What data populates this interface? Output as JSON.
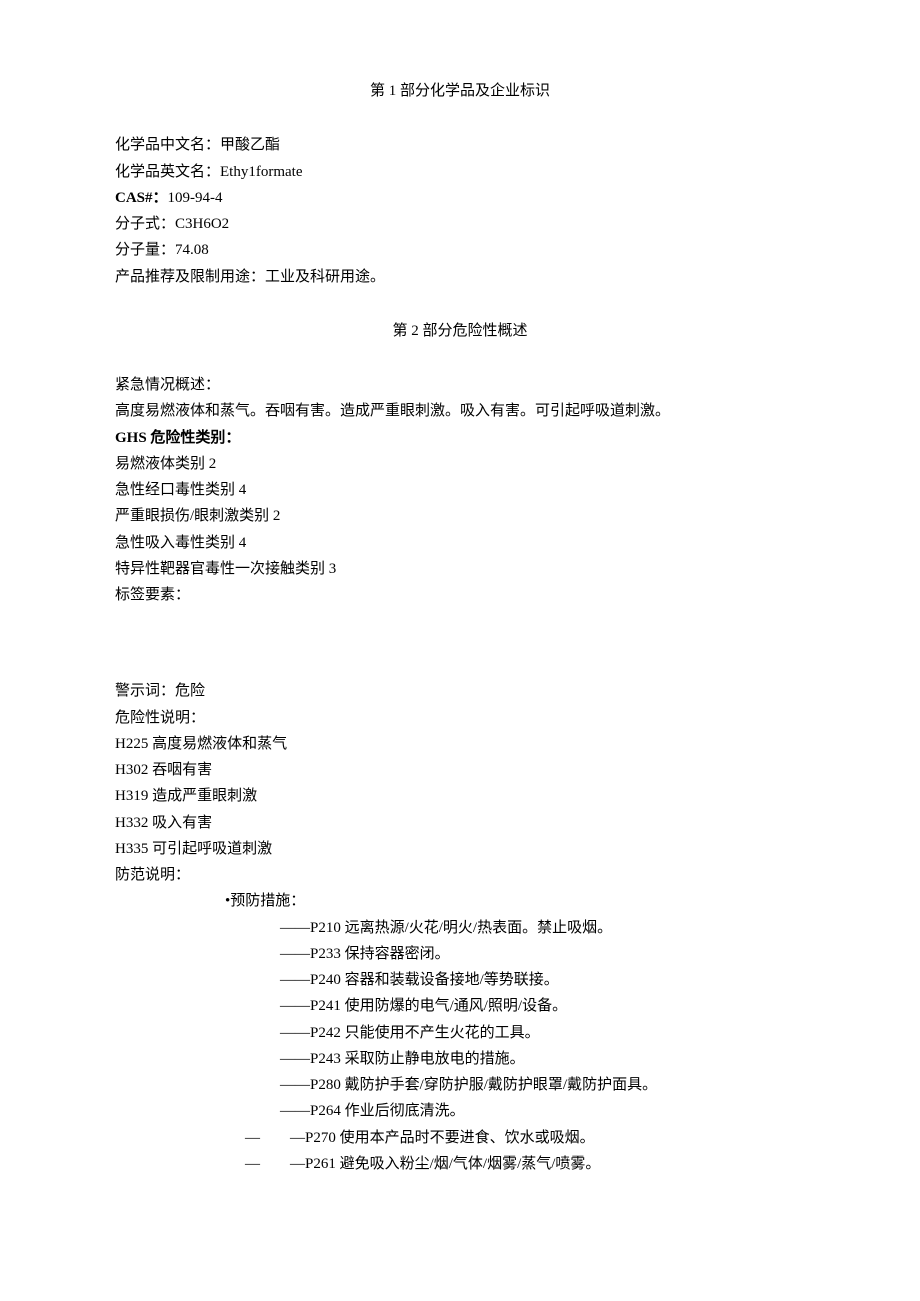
{
  "section1": {
    "title": "第 1 部分化学品及企业标识",
    "rows": {
      "name_cn_label": "化学品中文名：",
      "name_cn_value": "甲酸乙酯",
      "name_en_label": "化学品英文名：",
      "name_en_value": "Ethy1formate",
      "cas_label": "CAS#：",
      "cas_value": "109-94-4",
      "formula_label": "分子式：",
      "formula_value": "C3H6O2",
      "mw_label": "分子量：",
      "mw_value": "74.08",
      "use_label": "产品推荐及限制用途：",
      "use_value": "工业及科研用途。"
    }
  },
  "section2": {
    "title": "第 2 部分危险性概述",
    "emergency_label": "紧急情况概述：",
    "emergency_text": "高度易燃液体和蒸气。吞咽有害。造成严重眼刺激。吸入有害。可引起呼吸道刺激。",
    "ghs_label": "GHS 危险性类别：",
    "ghs_items": [
      "易燃液体类别 2",
      "急性经口毒性类别 4",
      "严重眼损伤/眼刺激类别 2",
      "急性吸入毒性类别 4",
      "特异性靶器官毒性一次接触类别 3"
    ],
    "label_elements": "标签要素：",
    "signal_label": "警示词：",
    "signal_value": "危险",
    "hazard_statement_label": "危险性说明：",
    "hazard_statements": [
      "H225 高度易燃液体和蒸气",
      "H302 吞咽有害",
      "H319 造成严重眼刺激",
      "H332 吸入有害",
      "H335 可引起呼吸道刺激"
    ],
    "precaution_label": "防范说明：",
    "prevention_header": "•预防措施：",
    "prevention_items": [
      "——P210 远离热源/火花/明火/热表面。禁止吸烟。",
      "——P233 保持容器密闭。",
      "——P240 容器和装载设备接地/等势联接。",
      "——P241 使用防爆的电气/通风/照明/设备。",
      "——P242 只能使用不产生火花的工具。",
      "——P243 采取防止静电放电的措施。",
      "——P280 戴防护手套/穿防护服/戴防护眼罩/戴防护面具。",
      "——P264 作业后彻底清洗。"
    ],
    "prevention_items_alt": [
      {
        "prefix": "—  —",
        "text": "P270 使用本产品时不要进食、饮水或吸烟。"
      },
      {
        "prefix": "—  —",
        "text": "P261 避免吸入粉尘/烟/气体/烟雾/蒸气/喷雾。"
      }
    ]
  }
}
